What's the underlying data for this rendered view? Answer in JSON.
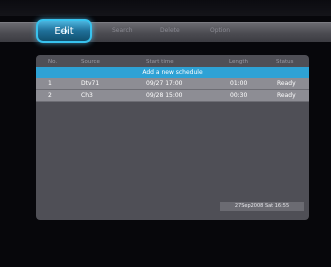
{
  "header": {
    "title": ""
  },
  "menu": {
    "edit_label": "Edit",
    "items": [
      {
        "label": "Search"
      },
      {
        "label": "Delete"
      },
      {
        "label": "Option"
      }
    ]
  },
  "table": {
    "columns": [
      "No.",
      "Source",
      "Start time",
      "Length",
      "Status"
    ],
    "add_label": "Add a new schedule",
    "rows": [
      {
        "no": "1",
        "source": "Dtv71",
        "start": "09/27 17:00",
        "length": "01:00",
        "status": "Ready"
      },
      {
        "no": "2",
        "source": "Ch3",
        "start": "09/28 15:00",
        "length": "00:30",
        "status": "Ready"
      }
    ]
  },
  "status_bar": {
    "datetime": "27Sep2008 Sat 16:55"
  },
  "colors": {
    "accent": "#2ea2d5",
    "panel": "#4f4f56",
    "row": "#8d8d94",
    "menu_bar": "#55555b"
  }
}
